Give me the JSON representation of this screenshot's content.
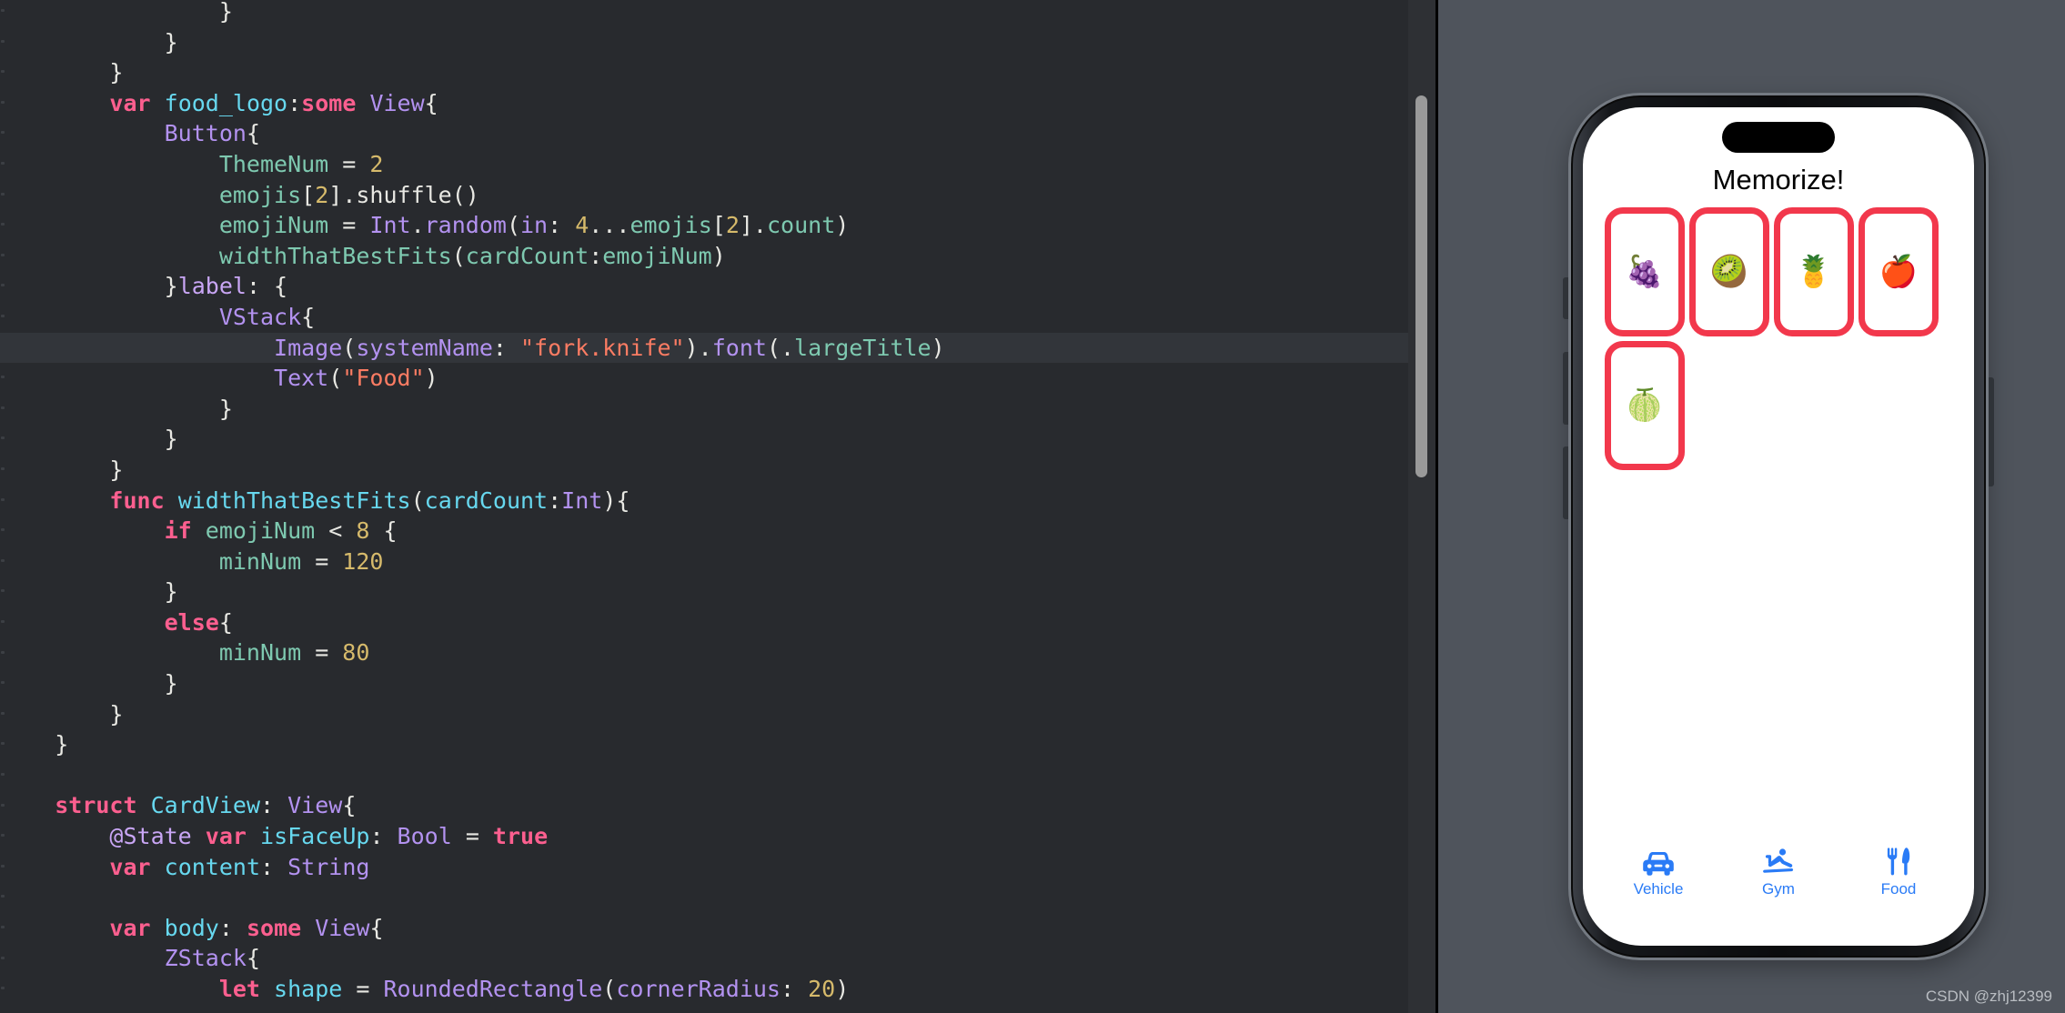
{
  "editor": {
    "language": "swift",
    "background": "#282a2e",
    "highlight_line_index": 11,
    "scrollbar_visible": true,
    "lines": [
      {
        "indent": 4,
        "tokens": [
          {
            "t": "plain",
            "v": "}"
          }
        ]
      },
      {
        "indent": 3,
        "tokens": [
          {
            "t": "plain",
            "v": "}"
          }
        ]
      },
      {
        "indent": 2,
        "tokens": [
          {
            "t": "plain",
            "v": "}"
          }
        ]
      },
      {
        "indent": 2,
        "tokens": [
          {
            "t": "kw",
            "v": "var"
          },
          {
            "t": "plain",
            "v": " "
          },
          {
            "t": "id",
            "v": "food_logo"
          },
          {
            "t": "plain",
            "v": ":"
          },
          {
            "t": "kw",
            "v": "some"
          },
          {
            "t": "plain",
            "v": " "
          },
          {
            "t": "type",
            "v": "View"
          },
          {
            "t": "plain",
            "v": "{"
          }
        ]
      },
      {
        "indent": 3,
        "tokens": [
          {
            "t": "type",
            "v": "Button"
          },
          {
            "t": "plain",
            "v": "{"
          }
        ]
      },
      {
        "indent": 4,
        "tokens": [
          {
            "t": "fn",
            "v": "ThemeNum"
          },
          {
            "t": "plain",
            "v": " = "
          },
          {
            "t": "num",
            "v": "2"
          }
        ]
      },
      {
        "indent": 4,
        "tokens": [
          {
            "t": "fn",
            "v": "emojis"
          },
          {
            "t": "plain",
            "v": "["
          },
          {
            "t": "num",
            "v": "2"
          },
          {
            "t": "plain",
            "v": "]."
          },
          {
            "t": "plain",
            "v": "shuffle()"
          }
        ]
      },
      {
        "indent": 4,
        "tokens": [
          {
            "t": "fn",
            "v": "emojiNum"
          },
          {
            "t": "plain",
            "v": " = "
          },
          {
            "t": "type",
            "v": "Int"
          },
          {
            "t": "plain",
            "v": "."
          },
          {
            "t": "mod",
            "v": "random"
          },
          {
            "t": "plain",
            "v": "("
          },
          {
            "t": "mod",
            "v": "in"
          },
          {
            "t": "plain",
            "v": ": "
          },
          {
            "t": "num",
            "v": "4"
          },
          {
            "t": "plain",
            "v": "..."
          },
          {
            "t": "fn",
            "v": "emojis"
          },
          {
            "t": "plain",
            "v": "["
          },
          {
            "t": "num",
            "v": "2"
          },
          {
            "t": "plain",
            "v": "]."
          },
          {
            "t": "fn",
            "v": "count"
          },
          {
            "t": "plain",
            "v": ")"
          }
        ]
      },
      {
        "indent": 4,
        "tokens": [
          {
            "t": "fn",
            "v": "widthThatBestFits"
          },
          {
            "t": "plain",
            "v": "("
          },
          {
            "t": "fn",
            "v": "cardCount"
          },
          {
            "t": "plain",
            "v": ":"
          },
          {
            "t": "fn",
            "v": "emojiNum"
          },
          {
            "t": "plain",
            "v": ")"
          }
        ]
      },
      {
        "indent": 3,
        "tokens": [
          {
            "t": "plain",
            "v": "}"
          },
          {
            "t": "label",
            "v": "label"
          },
          {
            "t": "plain",
            "v": ": {"
          }
        ]
      },
      {
        "indent": 4,
        "tokens": [
          {
            "t": "type",
            "v": "VStack"
          },
          {
            "t": "plain",
            "v": "{"
          }
        ]
      },
      {
        "indent": 5,
        "tokens": [
          {
            "t": "type",
            "v": "Image"
          },
          {
            "t": "plain",
            "v": "("
          },
          {
            "t": "mod",
            "v": "systemName"
          },
          {
            "t": "plain",
            "v": ": "
          },
          {
            "t": "str",
            "v": "\"fork.knife\""
          },
          {
            "t": "plain",
            "v": ")."
          },
          {
            "t": "mod",
            "v": "font"
          },
          {
            "t": "plain",
            "v": "(."
          },
          {
            "t": "fn",
            "v": "largeTitle"
          },
          {
            "t": "plain",
            "v": ")"
          }
        ]
      },
      {
        "indent": 5,
        "tokens": [
          {
            "t": "type",
            "v": "Text"
          },
          {
            "t": "plain",
            "v": "("
          },
          {
            "t": "str",
            "v": "\"Food\""
          },
          {
            "t": "plain",
            "v": ")"
          }
        ]
      },
      {
        "indent": 4,
        "tokens": [
          {
            "t": "plain",
            "v": "}"
          }
        ]
      },
      {
        "indent": 3,
        "tokens": [
          {
            "t": "plain",
            "v": "}"
          }
        ]
      },
      {
        "indent": 2,
        "tokens": [
          {
            "t": "plain",
            "v": "}"
          }
        ]
      },
      {
        "indent": 2,
        "tokens": [
          {
            "t": "kw",
            "v": "func"
          },
          {
            "t": "plain",
            "v": " "
          },
          {
            "t": "id",
            "v": "widthThatBestFits"
          },
          {
            "t": "plain",
            "v": "("
          },
          {
            "t": "id",
            "v": "cardCount"
          },
          {
            "t": "plain",
            "v": ":"
          },
          {
            "t": "type",
            "v": "Int"
          },
          {
            "t": "plain",
            "v": "){"
          }
        ]
      },
      {
        "indent": 3,
        "tokens": [
          {
            "t": "kw",
            "v": "if"
          },
          {
            "t": "plain",
            "v": " "
          },
          {
            "t": "fn",
            "v": "emojiNum"
          },
          {
            "t": "plain",
            "v": " < "
          },
          {
            "t": "num",
            "v": "8"
          },
          {
            "t": "plain",
            "v": " {"
          }
        ]
      },
      {
        "indent": 4,
        "tokens": [
          {
            "t": "fn",
            "v": "minNum"
          },
          {
            "t": "plain",
            "v": " = "
          },
          {
            "t": "num",
            "v": "120"
          }
        ]
      },
      {
        "indent": 3,
        "tokens": [
          {
            "t": "plain",
            "v": "}"
          }
        ]
      },
      {
        "indent": 3,
        "tokens": [
          {
            "t": "kw",
            "v": "else"
          },
          {
            "t": "plain",
            "v": "{"
          }
        ]
      },
      {
        "indent": 4,
        "tokens": [
          {
            "t": "fn",
            "v": "minNum"
          },
          {
            "t": "plain",
            "v": " = "
          },
          {
            "t": "num",
            "v": "80"
          }
        ]
      },
      {
        "indent": 3,
        "tokens": [
          {
            "t": "plain",
            "v": "}"
          }
        ]
      },
      {
        "indent": 2,
        "tokens": [
          {
            "t": "plain",
            "v": "}"
          }
        ]
      },
      {
        "indent": 1,
        "tokens": [
          {
            "t": "plain",
            "v": "}"
          }
        ]
      },
      {
        "indent": 0,
        "tokens": []
      },
      {
        "indent": 1,
        "tokens": [
          {
            "t": "kw",
            "v": "struct"
          },
          {
            "t": "plain",
            "v": " "
          },
          {
            "t": "id",
            "v": "CardView"
          },
          {
            "t": "plain",
            "v": ": "
          },
          {
            "t": "type",
            "v": "View"
          },
          {
            "t": "plain",
            "v": "{"
          }
        ]
      },
      {
        "indent": 2,
        "tokens": [
          {
            "t": "label",
            "v": "@State"
          },
          {
            "t": "plain",
            "v": " "
          },
          {
            "t": "kw",
            "v": "var"
          },
          {
            "t": "plain",
            "v": " "
          },
          {
            "t": "id",
            "v": "isFaceUp"
          },
          {
            "t": "plain",
            "v": ": "
          },
          {
            "t": "type",
            "v": "Bool"
          },
          {
            "t": "plain",
            "v": " = "
          },
          {
            "t": "kw",
            "v": "true"
          }
        ]
      },
      {
        "indent": 2,
        "tokens": [
          {
            "t": "kw",
            "v": "var"
          },
          {
            "t": "plain",
            "v": " "
          },
          {
            "t": "id",
            "v": "content"
          },
          {
            "t": "plain",
            "v": ": "
          },
          {
            "t": "type",
            "v": "String"
          }
        ]
      },
      {
        "indent": 0,
        "tokens": []
      },
      {
        "indent": 2,
        "tokens": [
          {
            "t": "kw",
            "v": "var"
          },
          {
            "t": "plain",
            "v": " "
          },
          {
            "t": "id",
            "v": "body"
          },
          {
            "t": "plain",
            "v": ": "
          },
          {
            "t": "kw",
            "v": "some"
          },
          {
            "t": "plain",
            "v": " "
          },
          {
            "t": "type",
            "v": "View"
          },
          {
            "t": "plain",
            "v": "{"
          }
        ]
      },
      {
        "indent": 3,
        "tokens": [
          {
            "t": "type",
            "v": "ZStack"
          },
          {
            "t": "plain",
            "v": "{"
          }
        ]
      },
      {
        "indent": 4,
        "tokens": [
          {
            "t": "kw",
            "v": "let"
          },
          {
            "t": "plain",
            "v": " "
          },
          {
            "t": "id",
            "v": "shape"
          },
          {
            "t": "plain",
            "v": " = "
          },
          {
            "t": "type",
            "v": "RoundedRectangle"
          },
          {
            "t": "plain",
            "v": "("
          },
          {
            "t": "mod",
            "v": "cornerRadius"
          },
          {
            "t": "plain",
            "v": ": "
          },
          {
            "t": "num",
            "v": "20"
          },
          {
            "t": "plain",
            "v": ")"
          }
        ]
      }
    ]
  },
  "preview": {
    "device": "iPhone",
    "app": {
      "title": "Memorize!",
      "card_border_color": "#f2384c",
      "cards": [
        {
          "emoji": "🍇",
          "name": "grapes"
        },
        {
          "emoji": "🥝",
          "name": "kiwi"
        },
        {
          "emoji": "🍍",
          "name": "pineapple"
        },
        {
          "emoji": "🍎",
          "name": "red-apple"
        },
        {
          "emoji": "🍈",
          "name": "melon"
        }
      ],
      "tabs": [
        {
          "label": "Vehicle",
          "icon": "car-icon"
        },
        {
          "label": "Gym",
          "icon": "figure-skiing-icon"
        },
        {
          "label": "Food",
          "icon": "fork-knife-icon"
        }
      ],
      "tab_tint": "#2a7bf6"
    }
  },
  "watermark": {
    "text": "CSDN @zhj12399"
  }
}
